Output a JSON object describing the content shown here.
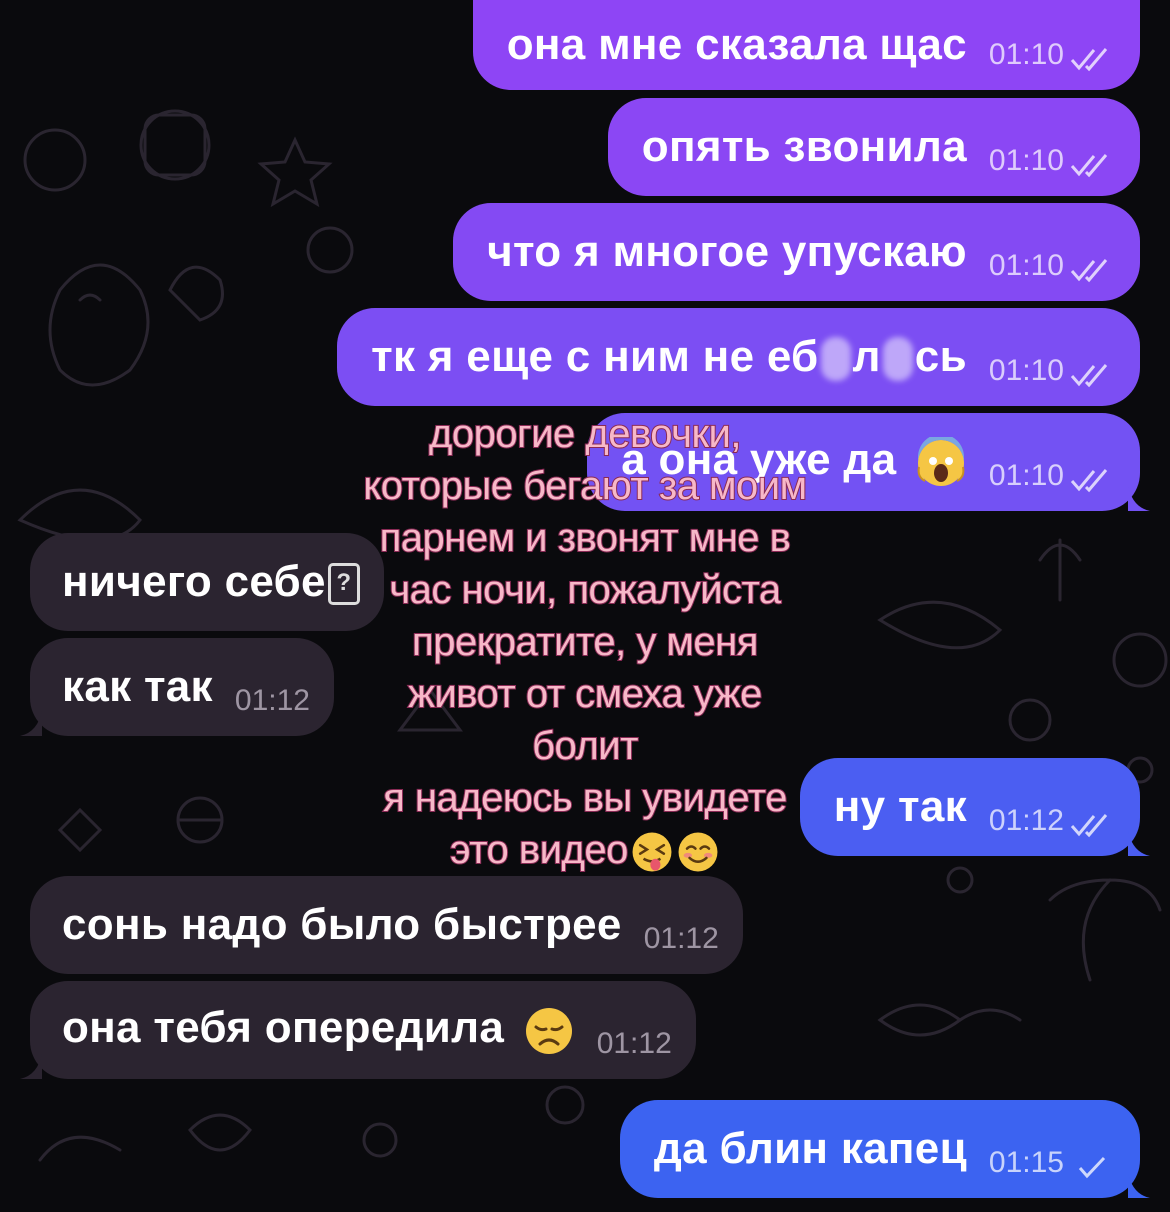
{
  "colors": {
    "background": "#0a0a0d",
    "outgoing_purple": "#8e45f5",
    "outgoing_blue": "#4b5ef2",
    "incoming": "#2b2430",
    "overlay_text": "#f7b8c8",
    "overlay_outline": "#8a2a55"
  },
  "messages": [
    {
      "text": "она мне сказала щас",
      "time": "01:10",
      "status": "read"
    },
    {
      "text": "опять звонила",
      "time": "01:10",
      "status": "read"
    },
    {
      "text": "что я многое упускаю",
      "time": "01:10",
      "status": "read"
    },
    {
      "text_a": "тк я еще с ним не еб",
      "text_b": "л",
      "text_c": "сь",
      "time": "01:10",
      "status": "read"
    },
    {
      "text": "а она уже да",
      "emoji": "screaming-face-emoji",
      "time": "01:10",
      "status": "read"
    },
    {
      "text": "ничего себе",
      "emoji": "unknown-glyph-box"
    },
    {
      "text": "как так",
      "time": "01:12"
    },
    {
      "text": "ну так",
      "time": "01:12",
      "status": "read"
    },
    {
      "text": "сонь надо было быстрее",
      "time": "01:12"
    },
    {
      "text": "она тебя опередила",
      "emoji": "disappointed-face-emoji",
      "time": "01:12"
    },
    {
      "text": "да блин капец",
      "time": "01:15",
      "status": "sent"
    }
  ],
  "overlay": {
    "lines": [
      "дорогие девочки,",
      "которые бегают за моим",
      "парнем и звонят мне в",
      "час ночи, пожалуйста",
      "прекратите, у меня",
      "живот от смеха уже",
      "болит",
      "я надеюсь вы увидете",
      "это видео"
    ],
    "emojis": [
      "squinting-tongue-emoji",
      "smiling-blush-emoji"
    ]
  }
}
